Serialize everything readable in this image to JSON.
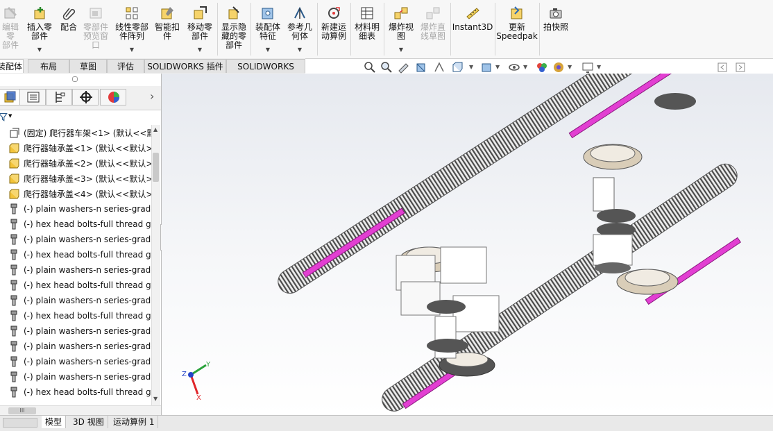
{
  "ribbon": {
    "buttons": [
      {
        "id": "edit-component",
        "l1": "编辑零",
        "l2": "部件",
        "l3": "",
        "disabled": true,
        "dropdown": false
      },
      {
        "id": "insert-component",
        "l1": "插入零",
        "l2": "部件",
        "l3": "",
        "disabled": false,
        "dropdown": true
      },
      {
        "id": "mate",
        "l1": "配合",
        "l2": "",
        "l3": "",
        "disabled": false,
        "dropdown": false
      },
      {
        "id": "component-preview",
        "l1": "零部件",
        "l2": "预览窗",
        "l3": "口",
        "disabled": true,
        "dropdown": false
      },
      {
        "id": "linear-pattern",
        "l1": "线性零部",
        "l2": "件阵列",
        "l3": "",
        "disabled": false,
        "dropdown": true
      },
      {
        "id": "smart-fasteners",
        "l1": "智能扣",
        "l2": "件",
        "l3": "",
        "disabled": false,
        "dropdown": false
      },
      {
        "id": "move-component",
        "l1": "移动零",
        "l2": "部件",
        "l3": "",
        "disabled": false,
        "dropdown": true
      },
      {
        "id": "show-hidden",
        "l1": "显示隐",
        "l2": "藏的零",
        "l3": "部件",
        "disabled": false,
        "dropdown": false
      },
      {
        "id": "assembly-features",
        "l1": "装配体",
        "l2": "特征",
        "l3": "",
        "disabled": false,
        "dropdown": true
      },
      {
        "id": "reference-geometry",
        "l1": "参考几",
        "l2": "何体",
        "l3": "",
        "disabled": false,
        "dropdown": true
      },
      {
        "id": "new-motion-study",
        "l1": "新建运",
        "l2": "动算例",
        "l3": "",
        "disabled": false,
        "dropdown": false
      },
      {
        "id": "bill-of-materials",
        "l1": "材料明",
        "l2": "细表",
        "l3": "",
        "disabled": false,
        "dropdown": false
      },
      {
        "id": "exploded-view",
        "l1": "爆炸视",
        "l2": "图",
        "l3": "",
        "disabled": false,
        "dropdown": true
      },
      {
        "id": "explode-line-sketch",
        "l1": "爆炸直",
        "l2": "线草图",
        "l3": "",
        "disabled": true,
        "dropdown": false
      },
      {
        "id": "instant3d",
        "l1": "Instant3D",
        "l2": "",
        "l3": "",
        "disabled": false,
        "dropdown": false
      },
      {
        "id": "update-speedpak",
        "l1": "更新",
        "l2": "Speedpak",
        "l3": "",
        "disabled": false,
        "dropdown": false
      },
      {
        "id": "snapshot",
        "l1": "拍快照",
        "l2": "",
        "l3": "",
        "disabled": false,
        "dropdown": false
      }
    ]
  },
  "tabs": [
    {
      "label": "装配体",
      "active": true
    },
    {
      "label": "布局",
      "active": false
    },
    {
      "label": "草图",
      "active": false
    },
    {
      "label": "评估",
      "active": false
    },
    {
      "label": "SOLIDWORKS 插件",
      "active": false
    },
    {
      "label": "SOLIDWORKS MBD",
      "active": false
    }
  ],
  "view_toolbar": [
    "zoom-to-fit-icon",
    "zoom-area-icon",
    "previous-view-icon",
    "section-view-icon",
    "dynamic-annotation-icon",
    "view-orientation-icon",
    "display-style-icon",
    "hide-show-items-icon",
    "edit-appearance-icon",
    "apply-scene-icon",
    "view-settings-icon"
  ],
  "feature_tree": {
    "panel_tabs": [
      "featuremanager-icon",
      "propertymanager-icon",
      "configurationmanager-icon",
      "dimxpert-icon",
      "displaymanager-icon"
    ],
    "filter_icon": "filter-icon",
    "items": [
      {
        "label": "(固定) 爬行器车架<1> (默认<<默",
        "type": "assembly"
      },
      {
        "label": "爬行器轴承盖<1> (默认<<默认>_",
        "type": "part"
      },
      {
        "label": "爬行器轴承盖<2> (默认<<默认>_",
        "type": "part"
      },
      {
        "label": "爬行器轴承盖<3> (默认<<默认>_",
        "type": "part"
      },
      {
        "label": "爬行器轴承盖<4> (默认<<默认>_",
        "type": "part"
      },
      {
        "label": "(-) plain washers-n series-grade",
        "type": "fastener"
      },
      {
        "label": "(-) hex head bolts-full thread gr",
        "type": "fastener"
      },
      {
        "label": "(-) plain washers-n series-grade",
        "type": "fastener"
      },
      {
        "label": "(-) hex head bolts-full thread gr",
        "type": "fastener"
      },
      {
        "label": "(-) plain washers-n series-grade",
        "type": "fastener"
      },
      {
        "label": "(-) hex head bolts-full thread gr",
        "type": "fastener"
      },
      {
        "label": "(-) plain washers-n series-grade",
        "type": "fastener"
      },
      {
        "label": "(-) hex head bolts-full thread gr",
        "type": "fastener"
      },
      {
        "label": "(-) plain washers-n series-grade",
        "type": "fastener"
      },
      {
        "label": "(-) plain washers-n series-grade",
        "type": "fastener"
      },
      {
        "label": "(-) plain washers-n series-grade",
        "type": "fastener"
      },
      {
        "label": "(-) plain washers-n series-grade",
        "type": "fastener"
      },
      {
        "label": "(-) hex head bolts-full thread gr",
        "type": "fastener"
      }
    ],
    "hscroll_thumb": "III"
  },
  "bottom_tabs": [
    {
      "label": "模型",
      "active": true
    },
    {
      "label": "3D 视图",
      "active": false
    },
    {
      "label": "运动算例 1",
      "active": false
    }
  ],
  "triad": {
    "x": "X",
    "y": "Y",
    "z": "Z"
  },
  "colors": {
    "track_accent": "#e23fd2",
    "ribbon_bg": "#f7f7f7",
    "axis_x": "#e0262a",
    "axis_y": "#2aa33b",
    "axis_z": "#2544c8"
  }
}
